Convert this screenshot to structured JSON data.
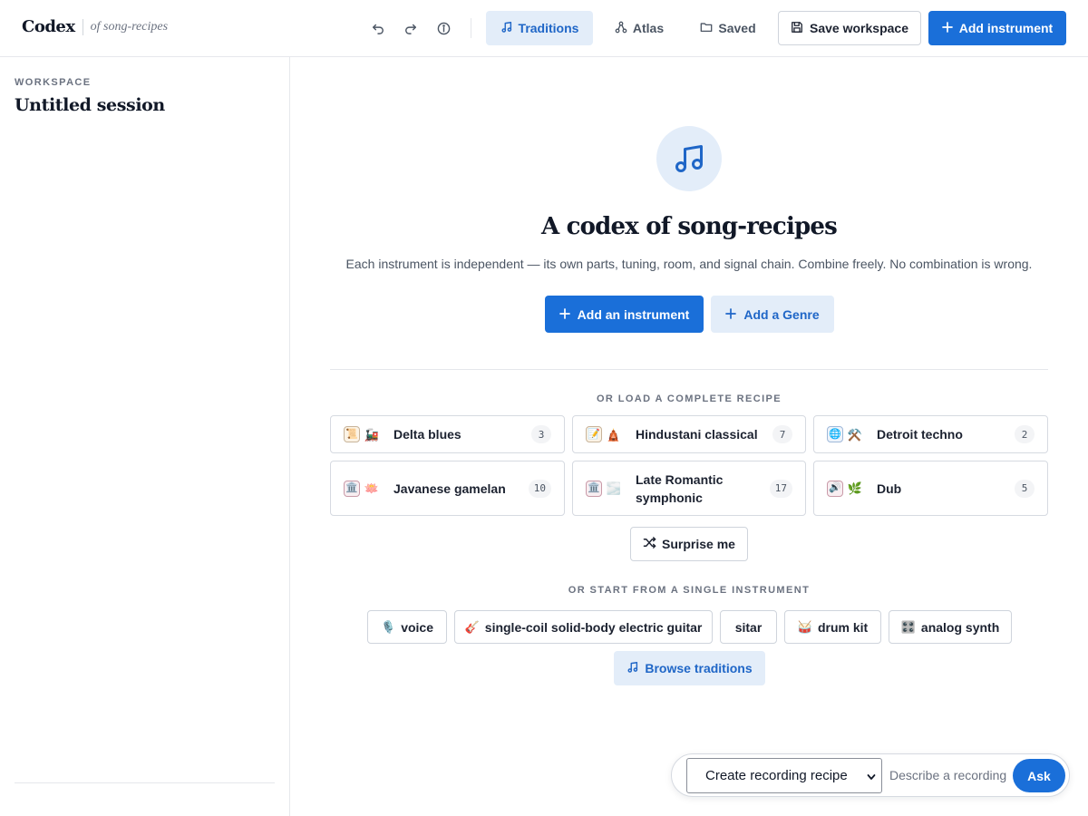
{
  "header": {
    "brand": "Codex",
    "subtitle": "of song-recipes",
    "undo_icon": "undo-icon",
    "redo_icon": "redo-icon",
    "info_icon": "info-icon",
    "tabs": [
      {
        "label": "Traditions",
        "icon": "music-note-icon",
        "active": true
      },
      {
        "label": "Atlas",
        "icon": "graph-icon",
        "active": false
      },
      {
        "label": "Saved",
        "icon": "folder-icon",
        "active": false
      }
    ],
    "save_label": "Save workspace",
    "add_label": "Add instrument"
  },
  "sidebar": {
    "section_label": "WORKSPACE",
    "title": "Untitled session"
  },
  "main": {
    "hero_icon": "music-note-icon",
    "title": "A codex of song-recipes",
    "subtitle": "Each instrument is independent — its own parts, tuning, room, and signal chain. Combine freely. No combination is wrong.",
    "add_instrument_label": "Add an instrument",
    "add_genre_label": "Add a Genre",
    "recipes_label": "OR LOAD A COMPLETE RECIPE",
    "recipes": [
      {
        "name": "Delta blues",
        "count": "3",
        "icons": [
          "📜",
          "🚂"
        ]
      },
      {
        "name": "Hindustani classical",
        "count": "7",
        "icons": [
          "📝",
          "🛕"
        ]
      },
      {
        "name": "Detroit techno",
        "count": "2",
        "icons": [
          "🌐",
          "⚒️"
        ]
      },
      {
        "name": "Javanese gamelan",
        "count": "10",
        "icons": [
          "🏛️",
          "🪷"
        ]
      },
      {
        "name": "Late Romantic symphonic",
        "count": "17",
        "icons": [
          "🏛️",
          "🌫️"
        ]
      },
      {
        "name": "Dub",
        "count": "5",
        "icons": [
          "🔊",
          "🌿"
        ]
      }
    ],
    "surprise_label": "Surprise me",
    "single_label": "OR START FROM A SINGLE INSTRUMENT",
    "instruments": [
      {
        "label": "voice",
        "emoji": "🎙️"
      },
      {
        "label": "single-coil solid-body electric guitar",
        "emoji": "🎸"
      },
      {
        "label": "sitar",
        "emoji": ""
      },
      {
        "label": "drum kit",
        "emoji": "🥁"
      },
      {
        "label": "analog synth",
        "emoji": "🎛️"
      }
    ],
    "browse_label": "Browse traditions"
  },
  "askbar": {
    "mode_selected": "Create recording recipe",
    "placeholder": "Describe a recording",
    "ask_label": "Ask"
  },
  "colors": {
    "accent": "#1a6fd9",
    "accent_soft": "#e3edf9",
    "accent_text": "#1f66c7",
    "border": "#d6dae1",
    "text": "#1c2230"
  }
}
